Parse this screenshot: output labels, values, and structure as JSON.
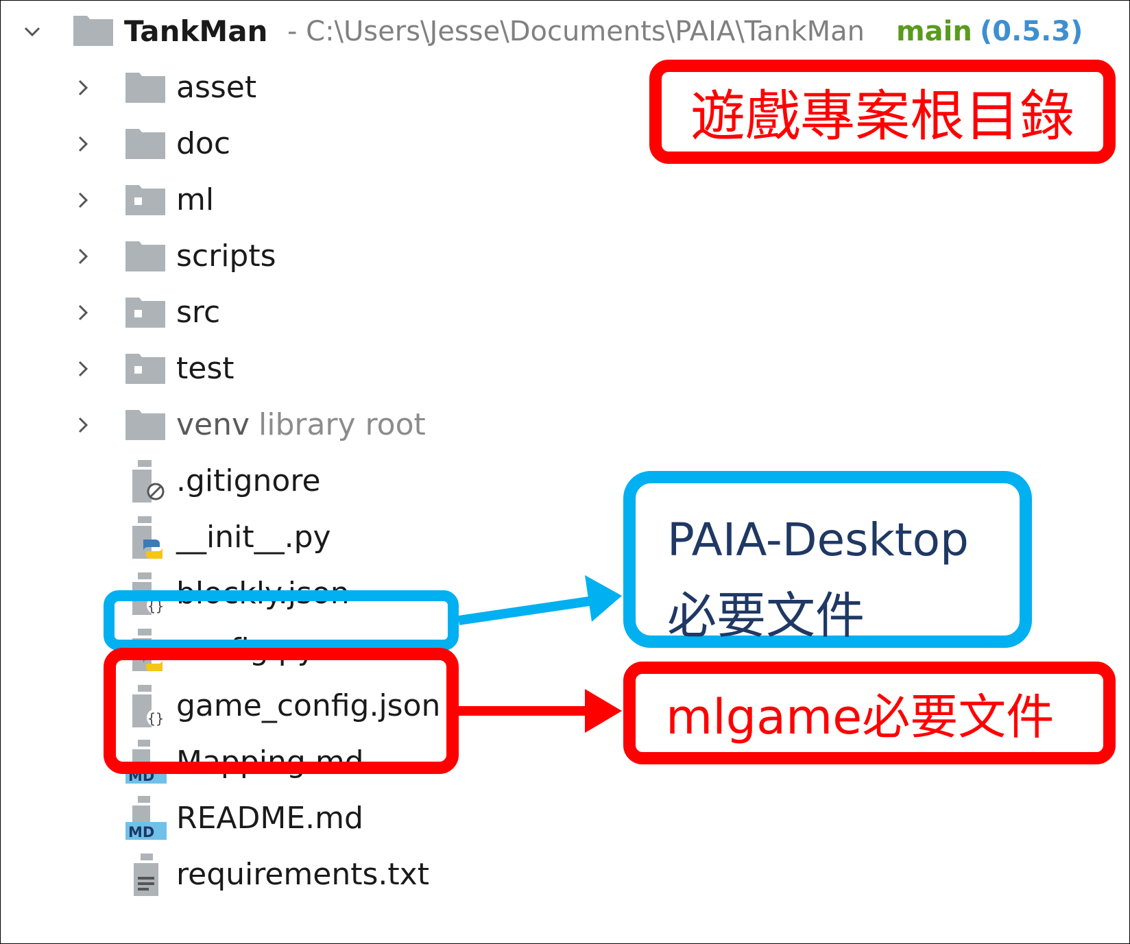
{
  "project": {
    "name": "TankMan",
    "path": "- C:\\Users\\Jesse\\Documents\\PAIA\\TankMan",
    "branch": "main",
    "version": "(0.5.3)"
  },
  "tree": [
    {
      "label": "asset",
      "kind": "folder"
    },
    {
      "label": "doc",
      "kind": "folder"
    },
    {
      "label": "ml",
      "kind": "package"
    },
    {
      "label": "scripts",
      "kind": "folder"
    },
    {
      "label": "src",
      "kind": "package"
    },
    {
      "label": "test",
      "kind": "package"
    },
    {
      "label": "venv",
      "kind": "folder",
      "suffix": "library root"
    },
    {
      "label": ".gitignore",
      "kind": "ignore"
    },
    {
      "label": "__init__.py",
      "kind": "python"
    },
    {
      "label": "blockly.json",
      "kind": "json"
    },
    {
      "label": "config.py",
      "kind": "python"
    },
    {
      "label": "game_config.json",
      "kind": "json"
    },
    {
      "label": "Mapping.md",
      "kind": "md"
    },
    {
      "label": "README.md",
      "kind": "md"
    },
    {
      "label": "requirements.txt",
      "kind": "txt"
    }
  ],
  "annotations": {
    "root_label": "遊戲專案根目錄",
    "paia_line1": "PAIA-Desktop",
    "paia_line2": "必要文件",
    "mlgame_label": "mlgame必要文件"
  },
  "colors": {
    "red": "#ff0000",
    "blue": "#00b0f0",
    "navy": "#1f3864",
    "folder": "#aeb3b8"
  }
}
